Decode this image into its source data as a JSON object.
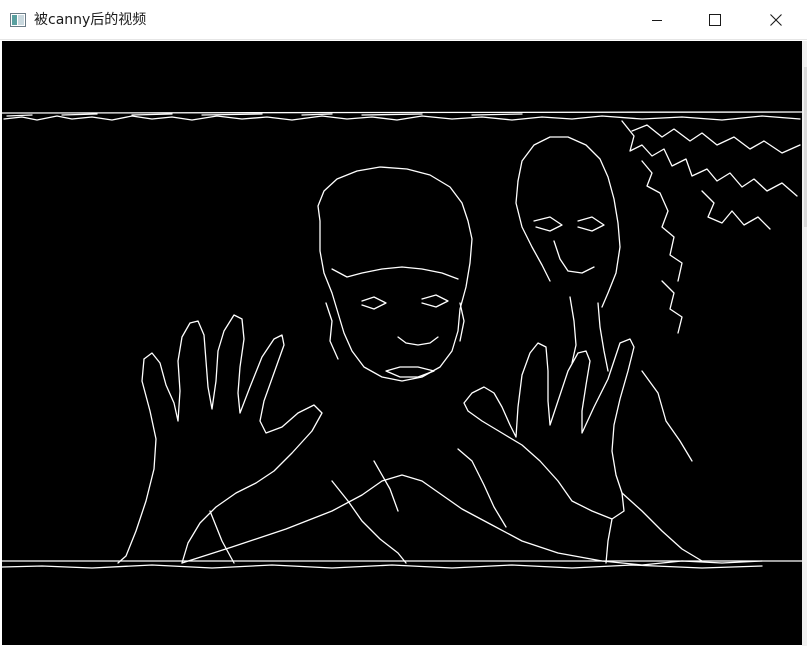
{
  "window": {
    "title": "被canny后的视频",
    "icons": {
      "app": "app-window-icon",
      "minimize": "minimize-icon",
      "maximize": "maximize-icon",
      "close": "close-icon"
    }
  },
  "video": {
    "content": "canny-edge-frame",
    "background": "#000000",
    "edge_color": "#ffffff"
  }
}
